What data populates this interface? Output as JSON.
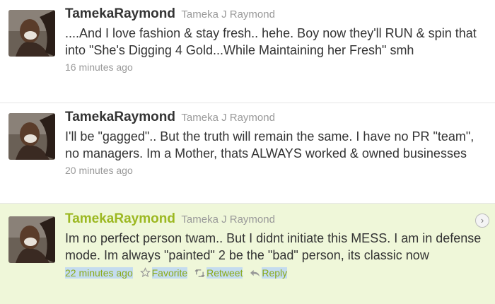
{
  "tweets": [
    {
      "screen_name": "TamekaRaymond",
      "full_name": "Tameka J Raymond",
      "text": "....And I love fashion & stay fresh.. hehe. Boy now they'll RUN & spin that into \"She's Digging 4 Gold...While Maintaining her Fresh\" smh",
      "time": "16 minutes ago"
    },
    {
      "screen_name": "TamekaRaymond",
      "full_name": "Tameka J Raymond",
      "text": "I'll be \"gagged\".. But the truth will remain the same. I have no PR \"team\", no managers. Im a Mother, thats ALWAYS worked & owned businesses",
      "time": "20 minutes ago"
    },
    {
      "screen_name": "TamekaRaymond",
      "full_name": "Tameka J Raymond",
      "text": "Im no perfect person twam.. But I didnt initiate this MESS. I am in defense mode. Im always \"painted\" 2 be the \"bad\" person, its classic now",
      "time": "22 minutes ago",
      "actions": {
        "favorite": "Favorite",
        "retweet": "Retweet",
        "reply": "Reply"
      }
    }
  ],
  "icons": {
    "favorite": "star-icon",
    "retweet": "retweet-icon",
    "reply": "reply-arrow-icon",
    "expand": "chevron-right-icon"
  },
  "colors": {
    "highlight_background": "#eff7d9",
    "highlight_name": "#9cb821",
    "selection": "#c4dcef",
    "meta_text": "#999999"
  }
}
